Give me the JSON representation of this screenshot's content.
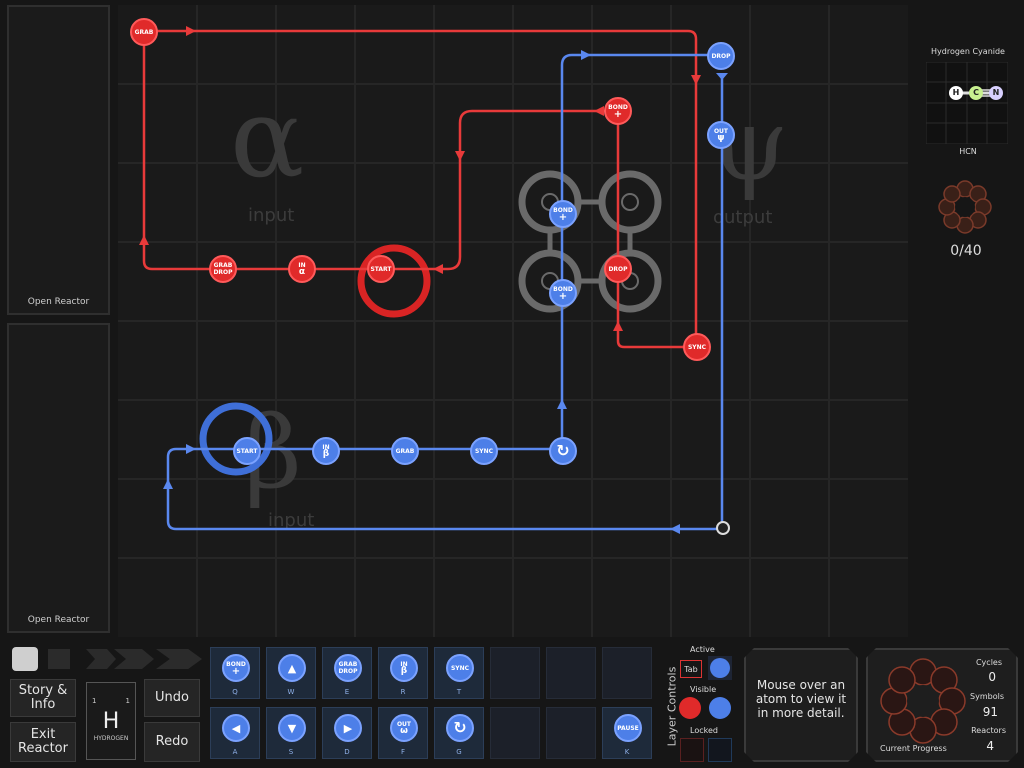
{
  "sidebar": {
    "slots": [
      {
        "label": "Open Reactor"
      },
      {
        "label": "Open Reactor"
      }
    ]
  },
  "reactor": {
    "input_alpha": {
      "glyph": "α",
      "label": "input"
    },
    "input_beta": {
      "glyph": "β",
      "label": "input"
    },
    "output_psi": {
      "glyph": "ψ",
      "label": "output"
    },
    "red_symbols": {
      "grab": "GRAB",
      "grab_drop_1": "GRAB",
      "grab_drop_2": "DROP",
      "in_1": "IN",
      "in_2": "α",
      "start": "START",
      "bond_1": "BOND",
      "bond_2": "+",
      "drop": "DROP",
      "sync": "SYNC"
    },
    "blue_symbols": {
      "drop": "DROP",
      "out_1": "OUT",
      "out_2": "ψ",
      "bond_a_1": "BOND",
      "bond_a_2": "+",
      "bond_b_1": "BOND",
      "bond_b_2": "+",
      "start": "START",
      "in_1": "IN",
      "in_2": "β",
      "grab": "GRAB",
      "sync": "SYNC",
      "rotate": "↻"
    }
  },
  "target": {
    "name": "Hydrogen Cyanide",
    "formula": "HCN",
    "atoms": [
      "H",
      "C",
      "N"
    ],
    "progress": "0/40"
  },
  "toolbar": {
    "story_label": "Story & Info",
    "exit_label": "Exit Reactor",
    "undo_label": "Undo",
    "redo_label": "Redo",
    "element": {
      "number_left": "1",
      "number_right": "1",
      "symbol": "H",
      "name": "HYDROGEN"
    },
    "tools_row1": [
      {
        "l1": "BOND",
        "l2": "+",
        "key": "Q"
      },
      {
        "l1": "▲",
        "l2": "",
        "key": "W"
      },
      {
        "l1": "GRAB",
        "l2": "DROP",
        "key": "E"
      },
      {
        "l1": "IN",
        "l2": "β",
        "key": "R"
      },
      {
        "l1": "SYNC",
        "l2": "",
        "key": "T"
      }
    ],
    "tools_row2": [
      {
        "l1": "◀",
        "l2": "",
        "key": "A"
      },
      {
        "l1": "▼",
        "l2": "",
        "key": "S"
      },
      {
        "l1": "▶",
        "l2": "",
        "key": "D"
      },
      {
        "l1": "OUT",
        "l2": "ω",
        "key": "F"
      },
      {
        "l1": "↻",
        "l2": "",
        "key": "G"
      }
    ],
    "pause_tool": {
      "l1": "PAUSE",
      "key": "K"
    }
  },
  "layer_controls": {
    "title": "Layer Controls",
    "active": "Active",
    "tab": "Tab",
    "visible": "Visible",
    "locked": "Locked"
  },
  "info": {
    "hover_text": "Mouse over an atom to view it in more detail."
  },
  "stats": {
    "cycles_label": "Cycles",
    "cycles": "0",
    "symbols_label": "Symbols",
    "symbols": "91",
    "reactors_label": "Reactors",
    "reactors": "4",
    "progress_label": "Current Progress"
  },
  "colors": {
    "red": "#e02a2a",
    "blue": "#4d7fe8",
    "bg": "#161616"
  }
}
